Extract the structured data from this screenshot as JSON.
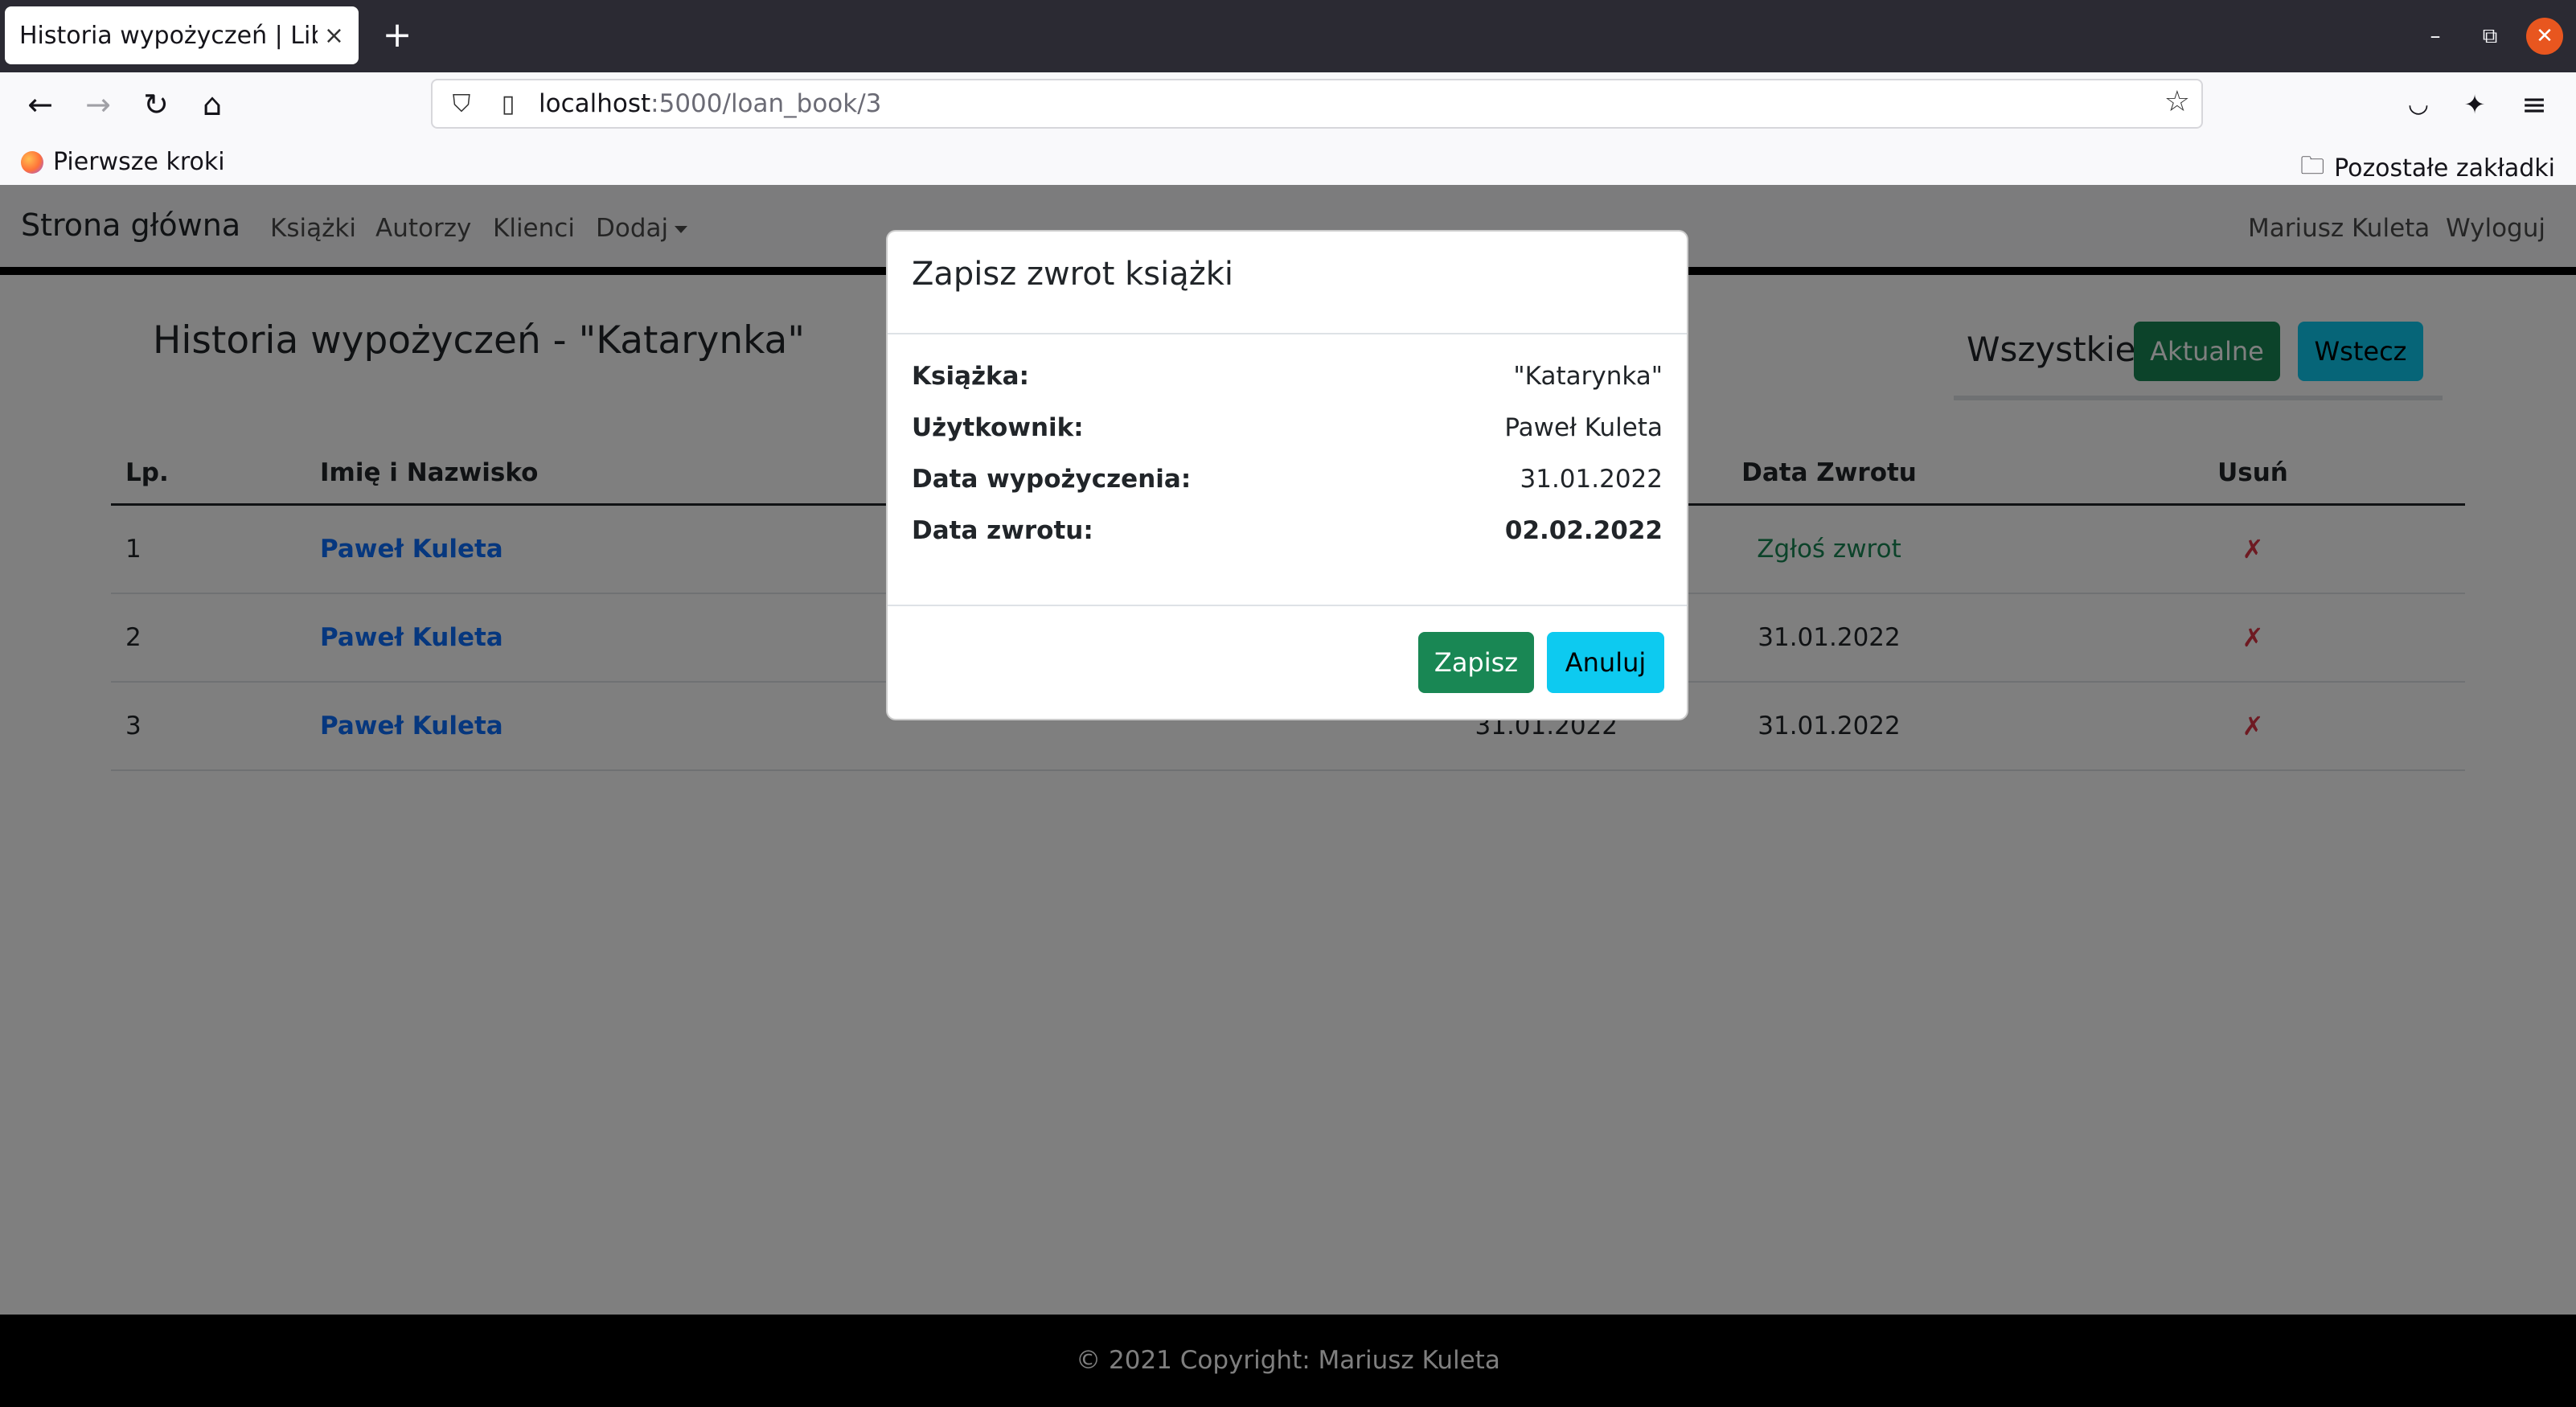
{
  "browser": {
    "tab_title": "Historia wypożyczeń | Library",
    "tab_close": "×",
    "new_tab": "+",
    "url_host": "localhost",
    "url_path": ":5000/loan_book/3",
    "bookmark_first": "Pierwsze kroki",
    "bookmark_other": "Pozostałe zakładki"
  },
  "site_nav": {
    "brand": "Strona główna",
    "links": [
      "Książki",
      "Autorzy",
      "Klienci",
      "Dodaj"
    ],
    "user": "Mariusz Kuleta",
    "logout": "Wyloguj"
  },
  "page": {
    "heading": "Historia wypożyczeń - \"Katarynka\"",
    "filter_all": "Wszystkie",
    "btn_current": "Aktualne",
    "btn_back": "Wstecz"
  },
  "table": {
    "headers": {
      "lp": "Lp.",
      "name": "Imię i Nazwisko",
      "return_date": "Data Zwrotu",
      "delete": "Usuń"
    },
    "rows": [
      {
        "lp": "1",
        "name": "Paweł Kuleta",
        "loan_date": "",
        "return": "Zgłoś zwrot",
        "delete": "✗"
      },
      {
        "lp": "2",
        "name": "Paweł Kuleta",
        "loan_date": "",
        "return": "31.01.2022",
        "delete": "✗"
      },
      {
        "lp": "3",
        "name": "Paweł Kuleta",
        "loan_date": "31.01.2022",
        "return": "31.01.2022",
        "delete": "✗"
      }
    ]
  },
  "footer": {
    "text": "© 2021 Copyright: Mariusz Kuleta"
  },
  "modal": {
    "title": "Zapisz zwrot książki",
    "book_label": "Książka:",
    "book_value": "\"Katarynka\"",
    "user_label": "Użytkownik:",
    "user_value": "Paweł Kuleta",
    "loan_label": "Data wypożyczenia:",
    "loan_value": "31.01.2022",
    "return_label": "Data zwrotu:",
    "return_value": "02.02.2022",
    "save": "Zapisz",
    "cancel": "Anuluj"
  },
  "colors": {
    "success": "#198754",
    "info": "#0dcaf0",
    "primary": "#0d6efd",
    "danger": "#dc3545"
  }
}
